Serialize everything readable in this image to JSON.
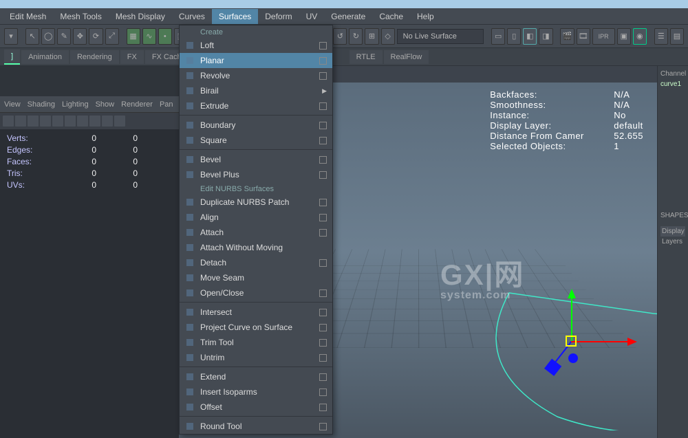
{
  "menubar": [
    "Edit Mesh",
    "Mesh Tools",
    "Mesh Display",
    "Curves",
    "Surfaces",
    "Deform",
    "UV",
    "Generate",
    "Cache",
    "Help"
  ],
  "active_menu_index": 4,
  "no_live_surface": "No Live Surface",
  "shelf_tabs_left": [
    "",
    "Animation",
    "Rendering",
    "FX",
    "FX Cach"
  ],
  "shelf_tabs_right": [
    "RTLE",
    "RealFlow"
  ],
  "panel_header": [
    "View",
    "Shading",
    "Lighting",
    "Show",
    "Renderer",
    "Pan"
  ],
  "stats": [
    {
      "k": "Verts:",
      "a": "0",
      "b": "0"
    },
    {
      "k": "Edges:",
      "a": "0",
      "b": "0"
    },
    {
      "k": "Faces:",
      "a": "0",
      "b": "0"
    },
    {
      "k": "Tris:",
      "a": "0",
      "b": "0"
    },
    {
      "k": "UVs:",
      "a": "0",
      "b": "0"
    }
  ],
  "hud": [
    {
      "k": "Backfaces:",
      "v": "N/A"
    },
    {
      "k": "Smoothness:",
      "v": "N/A"
    },
    {
      "k": "Instance:",
      "v": "No"
    },
    {
      "k": "Display Layer:",
      "v": "default"
    },
    {
      "k": "Distance From Camer",
      "v": "52.655"
    },
    {
      "k": "Selected Objects:",
      "v": "1"
    }
  ],
  "right_pane": {
    "channel": "Channel",
    "curve": "curve1",
    "shapes": "SHAPES",
    "display": "Display",
    "layers": "Layers"
  },
  "watermark": {
    "line1": "GX|网",
    "line2": "system.com"
  },
  "dropdown": {
    "sections": [
      {
        "header": "Create",
        "items": [
          {
            "label": "Loft",
            "opt": true
          },
          {
            "label": "Planar",
            "opt": true,
            "hl": true
          },
          {
            "label": "Revolve",
            "opt": true
          },
          {
            "label": "Birail",
            "sub": true
          },
          {
            "label": "Extrude",
            "opt": true
          },
          {
            "sep": true
          },
          {
            "label": "Boundary",
            "opt": true
          },
          {
            "label": "Square",
            "opt": true
          },
          {
            "sep": true
          },
          {
            "label": "Bevel",
            "opt": true
          },
          {
            "label": "Bevel Plus",
            "opt": true
          }
        ]
      },
      {
        "header": "Edit NURBS Surfaces",
        "items": [
          {
            "label": "Duplicate NURBS Patch",
            "opt": true
          },
          {
            "label": "Align",
            "opt": true
          },
          {
            "label": "Attach",
            "opt": true
          },
          {
            "label": "Attach Without Moving"
          },
          {
            "label": "Detach",
            "opt": true
          },
          {
            "label": "Move Seam"
          },
          {
            "label": "Open/Close",
            "opt": true
          },
          {
            "sep": true
          },
          {
            "label": "Intersect",
            "opt": true
          },
          {
            "label": "Project Curve on Surface",
            "opt": true
          },
          {
            "label": "Trim Tool",
            "opt": true
          },
          {
            "label": "Untrim",
            "opt": true
          },
          {
            "sep": true
          },
          {
            "label": "Extend",
            "opt": true
          },
          {
            "label": "Insert Isoparms",
            "opt": true
          },
          {
            "label": "Offset",
            "opt": true
          },
          {
            "sep": true
          },
          {
            "label": "Round Tool",
            "opt": true
          }
        ]
      }
    ]
  }
}
